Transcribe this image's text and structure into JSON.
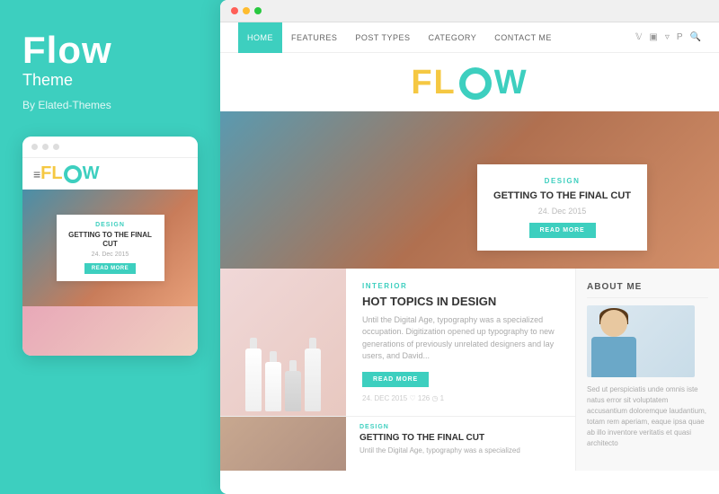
{
  "left": {
    "brand": {
      "title": "Flow",
      "subtitle": "Theme",
      "by": "By Elated-Themes"
    },
    "mobile_preview": {
      "dots": [
        "dot1",
        "dot2",
        "dot3"
      ],
      "logo": {
        "fl": "FL",
        "w": "W"
      },
      "card": {
        "category": "DESIGN",
        "title": "GETTING TO THE FINAL CUT",
        "date": "24. Dec 2015",
        "read_more": "READ MORE"
      }
    }
  },
  "right": {
    "browser_dots": [
      "red",
      "yellow",
      "green"
    ],
    "nav": {
      "links": [
        "HOME",
        "FEATURES",
        "POST TYPES",
        "CATEGORY",
        "CONTACT ME"
      ],
      "active": "HOME",
      "icons": [
        "▿",
        "▣",
        "▿",
        "P",
        "🔍"
      ]
    },
    "logo": {
      "fl": "FL",
      "w": "W"
    },
    "hero": {
      "card": {
        "category": "DESIGN",
        "title": "GETTING TO THE FINAL CUT",
        "date": "24. Dec 2015",
        "read_more": "READ MORE"
      }
    },
    "posts": [
      {
        "category": "INTERIOR",
        "title": "HOT TOPICS IN DESIGN",
        "excerpt": "Until the Digital Age, typography was a specialized occupation. Digitization opened up typography to new generations of previously unrelated designers and lay users, and David...",
        "read_more": "READ MORE",
        "meta": "24. DEC 2015   ♡ 126   ◷ 1"
      },
      {
        "category": "DESIGN",
        "title": "GETTING TO THE FINAL CUT",
        "excerpt": "Until the Digital Age, typography was a specialized"
      }
    ],
    "sidebar": {
      "title": "ABOUT ME",
      "bio": "Sed ut perspiciatis unde omnis iste natus error sit voluptatem accusantium doloremque laudantium, totam rem aperiam, eaque ipsa quae ab illo inventore veritatis et quasi architecto"
    }
  }
}
